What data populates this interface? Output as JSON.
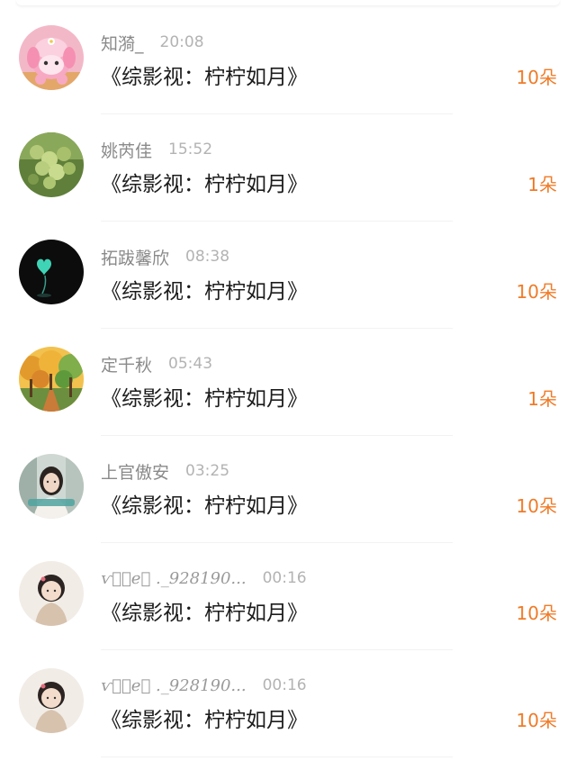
{
  "colors": {
    "accent": "#f07b28",
    "name_text": "#8a8a8a",
    "time_text": "#b3b3b3",
    "title_text": "#1c1c1c"
  },
  "rows": [
    {
      "avatar": "pink-sheep-avatar",
      "name": "知漪_",
      "time": "20:08",
      "title": "《综影视：柠柠如月》",
      "count": "10朵"
    },
    {
      "avatar": "green-grapes-avatar",
      "name": "姚芮佳",
      "time": "15:52",
      "title": "《综影视：柠柠如月》",
      "count": "1朵"
    },
    {
      "avatar": "dark-heart-balloon-avatar",
      "name": "拓跋馨欣",
      "time": "08:38",
      "title": "《综影视：柠柠如月》",
      "count": "10朵"
    },
    {
      "avatar": "autumn-trees-avatar",
      "name": "定千秋",
      "time": "05:43",
      "title": "《综影视：柠柠如月》",
      "count": "1朵"
    },
    {
      "avatar": "girl-portrait-avatar",
      "name": "上官傲安",
      "time": "03:25",
      "title": "《综影视：柠柠如月》",
      "count": "10朵"
    },
    {
      "avatar": "toddler-avatar",
      "name": "ѵℵͩ𝑒𝓌 ._928190...",
      "time": "00:16",
      "title": "《综影视：柠柠如月》",
      "count": "10朵"
    },
    {
      "avatar": "toddler-avatar",
      "name": "ѵℵͩ𝑒𝓌 ._928190...",
      "time": "00:16",
      "title": "《综影视：柠柠如月》",
      "count": "10朵"
    }
  ]
}
